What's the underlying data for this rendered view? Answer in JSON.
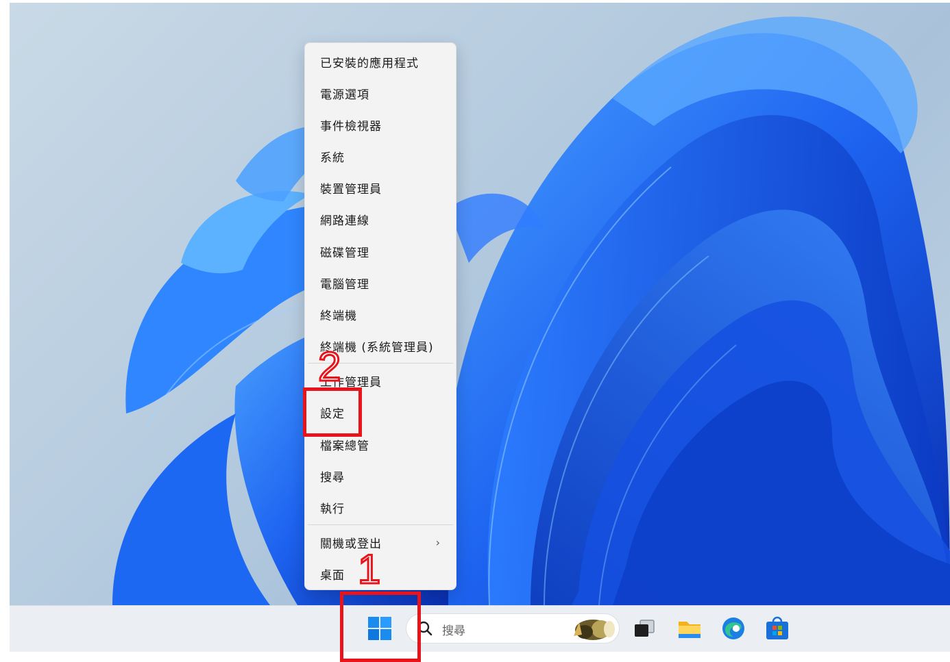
{
  "menu": {
    "items": [
      {
        "label": "已安裝的應用程式"
      },
      {
        "label": "電源選項"
      },
      {
        "label": "事件檢視器"
      },
      {
        "label": "系統"
      },
      {
        "label": "裝置管理員"
      },
      {
        "label": "網路連線"
      },
      {
        "label": "磁碟管理"
      },
      {
        "label": "電腦管理"
      },
      {
        "label": "終端機"
      },
      {
        "label": "終端機 (系統管理員)"
      },
      {
        "label": "工作管理員"
      },
      {
        "label": "設定"
      },
      {
        "label": "檔案總管"
      },
      {
        "label": "搜尋"
      },
      {
        "label": "執行"
      },
      {
        "label": "關機或登出"
      },
      {
        "label": "桌面"
      }
    ]
  },
  "taskbar": {
    "search_placeholder": "搜尋",
    "icons": [
      "windows-start-icon",
      "task-view-icon",
      "file-explorer-icon",
      "edge-icon",
      "microsoft-store-icon"
    ]
  },
  "annotations": {
    "step1": "1",
    "step2": "2",
    "color": "#e8141b"
  },
  "colors": {
    "wallpaper_blue": "#1f63e6",
    "menu_bg": "#f3f3f3",
    "taskbar_bg": "#ebeef3"
  }
}
